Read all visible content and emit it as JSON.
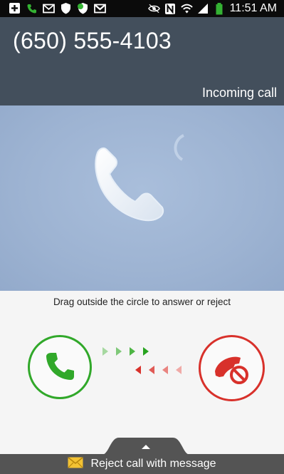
{
  "status_bar": {
    "time": "11:51 AM",
    "icons": [
      "plus-square-icon",
      "phone-icon",
      "mail-icon",
      "shield-icon",
      "sync-shield-icon",
      "gmail-icon",
      "eye-icon",
      "nfc-icon",
      "wifi-icon",
      "signal-icon",
      "battery-icon"
    ]
  },
  "call": {
    "number": "(650) 555-4103",
    "status": "Incoming call"
  },
  "controls": {
    "instruction": "Drag outside the circle to answer or reject"
  },
  "bottom": {
    "reject_with_message": "Reject call with message"
  },
  "colors": {
    "answer": "#31a82a",
    "reject": "#d8312b",
    "header_bg": "#434f5c",
    "photo_bg": "#9db3d2"
  }
}
